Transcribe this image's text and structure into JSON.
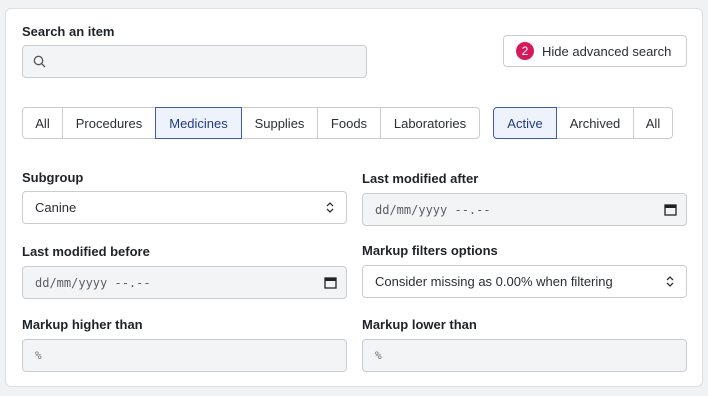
{
  "search": {
    "label": "Search an item",
    "placeholder": ""
  },
  "advanced_button": {
    "badge": "2",
    "label": "Hide advanced search"
  },
  "category_tabs": [
    "All",
    "Procedures",
    "Medicines",
    "Supplies",
    "Foods",
    "Laboratories"
  ],
  "category_selected": "Medicines",
  "status_tabs": [
    "Active",
    "Archived",
    "All"
  ],
  "status_selected": "Active",
  "subgroup": {
    "label": "Subgroup",
    "value": "Canine"
  },
  "last_modified_after": {
    "label": "Last modified after",
    "value": "dd/mm/yyyy --.--"
  },
  "last_modified_before": {
    "label": "Last modified before",
    "value": "dd/mm/yyyy --.--"
  },
  "markup_filter_options": {
    "label": "Markup filters options",
    "value": "Consider missing as 0.00% when filtering"
  },
  "markup_higher": {
    "label": "Markup higher than",
    "unit": "%"
  },
  "markup_lower": {
    "label": "Markup lower than",
    "unit": "%"
  },
  "colors": {
    "accent": "#3c5bb8",
    "badge": "#d6195b",
    "input_bg": "#f3f4f6",
    "border": "#c9ccd1"
  },
  "icons": {
    "search": "search-icon",
    "calendar": "calendar-icon",
    "select": "chevron-updown-icon"
  }
}
